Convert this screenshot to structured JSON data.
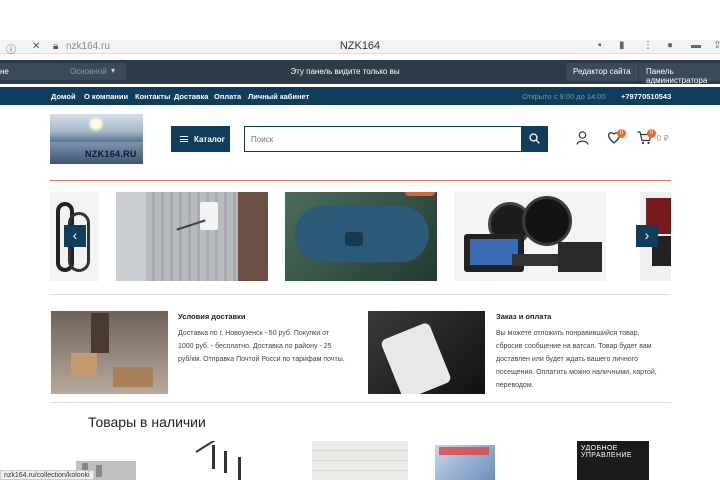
{
  "browser": {
    "url": "nzk164.ru",
    "tab_title": "NZK164"
  },
  "admin_bar": {
    "select_left": "не",
    "select_value": "Основной",
    "notice": "Эту панель видите только вы",
    "site_editor": "Редактор сайта",
    "admin_panel": "Панель администратора"
  },
  "nav": {
    "items": [
      "Домой",
      "О компании",
      "Контакты",
      "Доставка",
      "Оплата",
      "Личный кабинет"
    ],
    "hours": "Открыто с 9:00 до 14:00",
    "phone": "+79770510543"
  },
  "header": {
    "logo_text": "NZK164.RU",
    "catalog_label": "Каталог",
    "search_placeholder": "Поиск",
    "favorites_count": "0",
    "cart_count": "0",
    "cart_sum": "0 ₽"
  },
  "info": {
    "delivery": {
      "title": "Условия доставки",
      "lines": [
        "Доставка по г. Новоузенск - 50 руб. Покупки от",
        "1000 руб. - бесплатно. Доставка по району - 25",
        "руб/км. Отправка Почтой Росси по тарифам почты."
      ]
    },
    "order": {
      "title": "Заказ и оплата",
      "lines": [
        "Вы можете отложить понравившийся товар,",
        "сбросив сообщение на ватсап. Товар будет вам",
        "доставлен или будет ждать вашего личного",
        "посещения. Оплатить можно наличными, картой,",
        "переводом."
      ]
    }
  },
  "products_title": "Товары в наличии",
  "status_url": "nzk164.ru/collection/kolonki",
  "colors": {
    "primary": "#0f3e5c",
    "accent": "#f26a2a",
    "admin_bar": "#2d3b48"
  }
}
